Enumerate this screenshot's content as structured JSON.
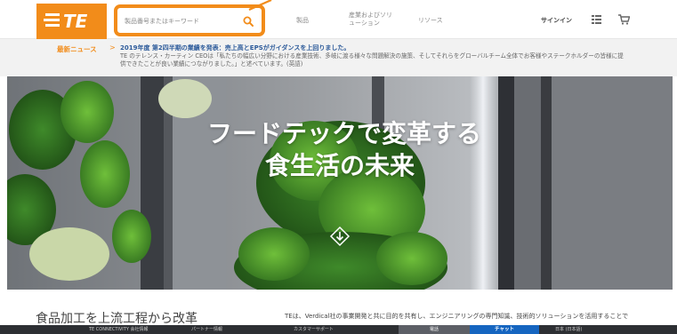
{
  "header": {
    "logo_alt": "TE connectivity",
    "search": {
      "placeholder": "製品番号またはキーワード"
    },
    "nav": {
      "products": "製品",
      "industries": "産業およびソリューション",
      "resources": "リソース"
    },
    "signin": "サインイン"
  },
  "news": {
    "label": "最新ニュース",
    "chevron": ">",
    "headline": "2019年度 第2四半期の業績を発表：売上高とEPSがガイダンスを上回りました。",
    "body": "TE のテレンス・カーティン CEOは「私たちの幅広い分野における産業技術、多岐に渡る様々な問題解決の施策、そしてそれらをグローバルチーム全体でお客様やステークホルダーの皆様に提供できたことが良い業績につながりました。」と述べています。(英語)"
  },
  "hero": {
    "title_line1": "フードテックで変革する",
    "title_line2": "食生活の未来"
  },
  "section": {
    "title": "食品加工を上流工程から改革",
    "description": "TEは、Verdical社の事業開発と共に目的を共有し、エンジニアリングの専門知識、技術的ソリューションを活用することで"
  },
  "footer": {
    "items": [
      "TE CONNECTIVITY 会社情報",
      "パートナー情報",
      "カスタマーサポート"
    ],
    "phone": "電話",
    "chat": "チャット",
    "lang": "日本 (日本語)"
  },
  "colors": {
    "brand_orange": "#f28c1a",
    "news_blue": "#2c5a9a",
    "chat_blue": "#1565c0",
    "footer_dark": "#2d2f33"
  }
}
